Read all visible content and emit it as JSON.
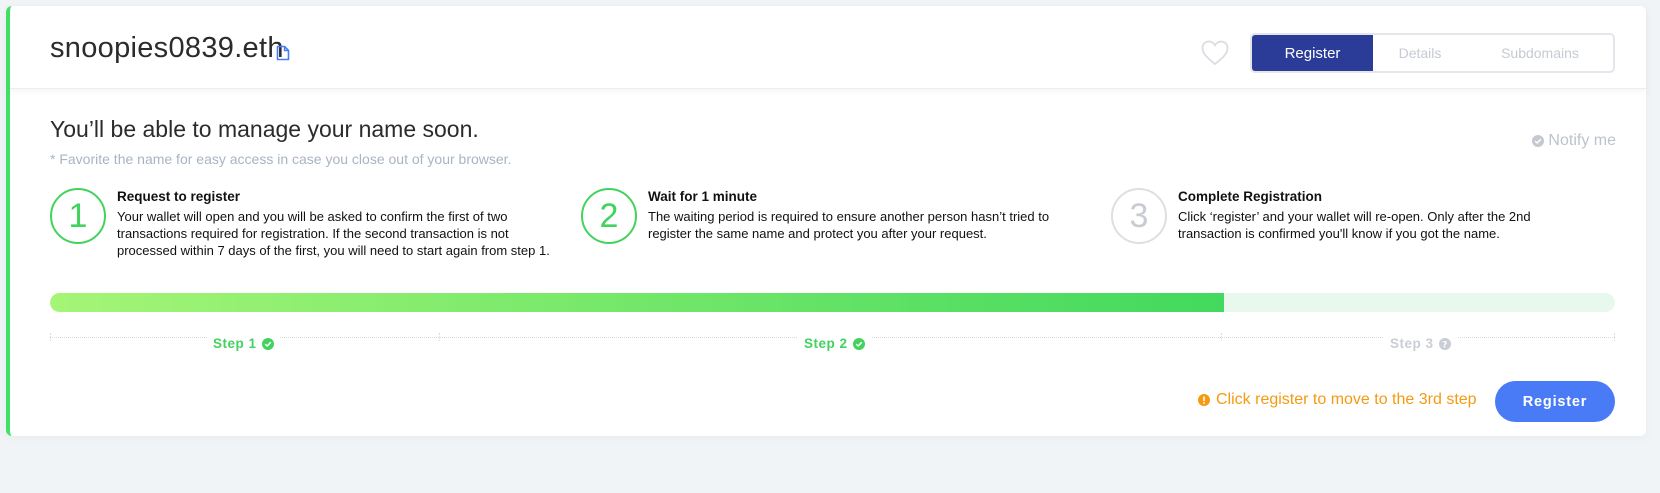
{
  "domain": {
    "name": "snoopies0839.eth"
  },
  "tabs": [
    {
      "label": "Register",
      "active": true
    },
    {
      "label": "Details",
      "active": false
    },
    {
      "label": "Subdomains",
      "active": false
    }
  ],
  "main": {
    "title": "You’ll be able to manage your name soon.",
    "subtitle": "* Favorite the name for easy access in case you close out of your browser.",
    "notify_label": "Notify me"
  },
  "steps": [
    {
      "number": "1",
      "title": "Request to register",
      "description": "Your wallet will open and you will be asked to confirm the first of two transactions required for registration. If the second transaction is not processed within 7 days of the first, you will need to start again from step 1.",
      "status": "done"
    },
    {
      "number": "2",
      "title": "Wait for 1 minute",
      "description": "The waiting period is required to ensure another person hasn’t tried to register the same name and protect you after your request.",
      "status": "done"
    },
    {
      "number": "3",
      "title": "Complete Registration",
      "description": "Click ‘register’ and your wallet will re-open. Only after the 2nd transaction is confirmed you'll know if you got the name.",
      "status": "pending"
    }
  ],
  "progress": {
    "fraction": 0.75
  },
  "step_labels": [
    "Step 1",
    "Step 2",
    "Step 3"
  ],
  "footer": {
    "warning": "Click register to move to the 3rd step",
    "register_label": "Register"
  },
  "colors": {
    "accent": "#42d35e",
    "tab_active": "#2b3b98",
    "button": "#4a7bf6",
    "warning": "#f59a12"
  }
}
